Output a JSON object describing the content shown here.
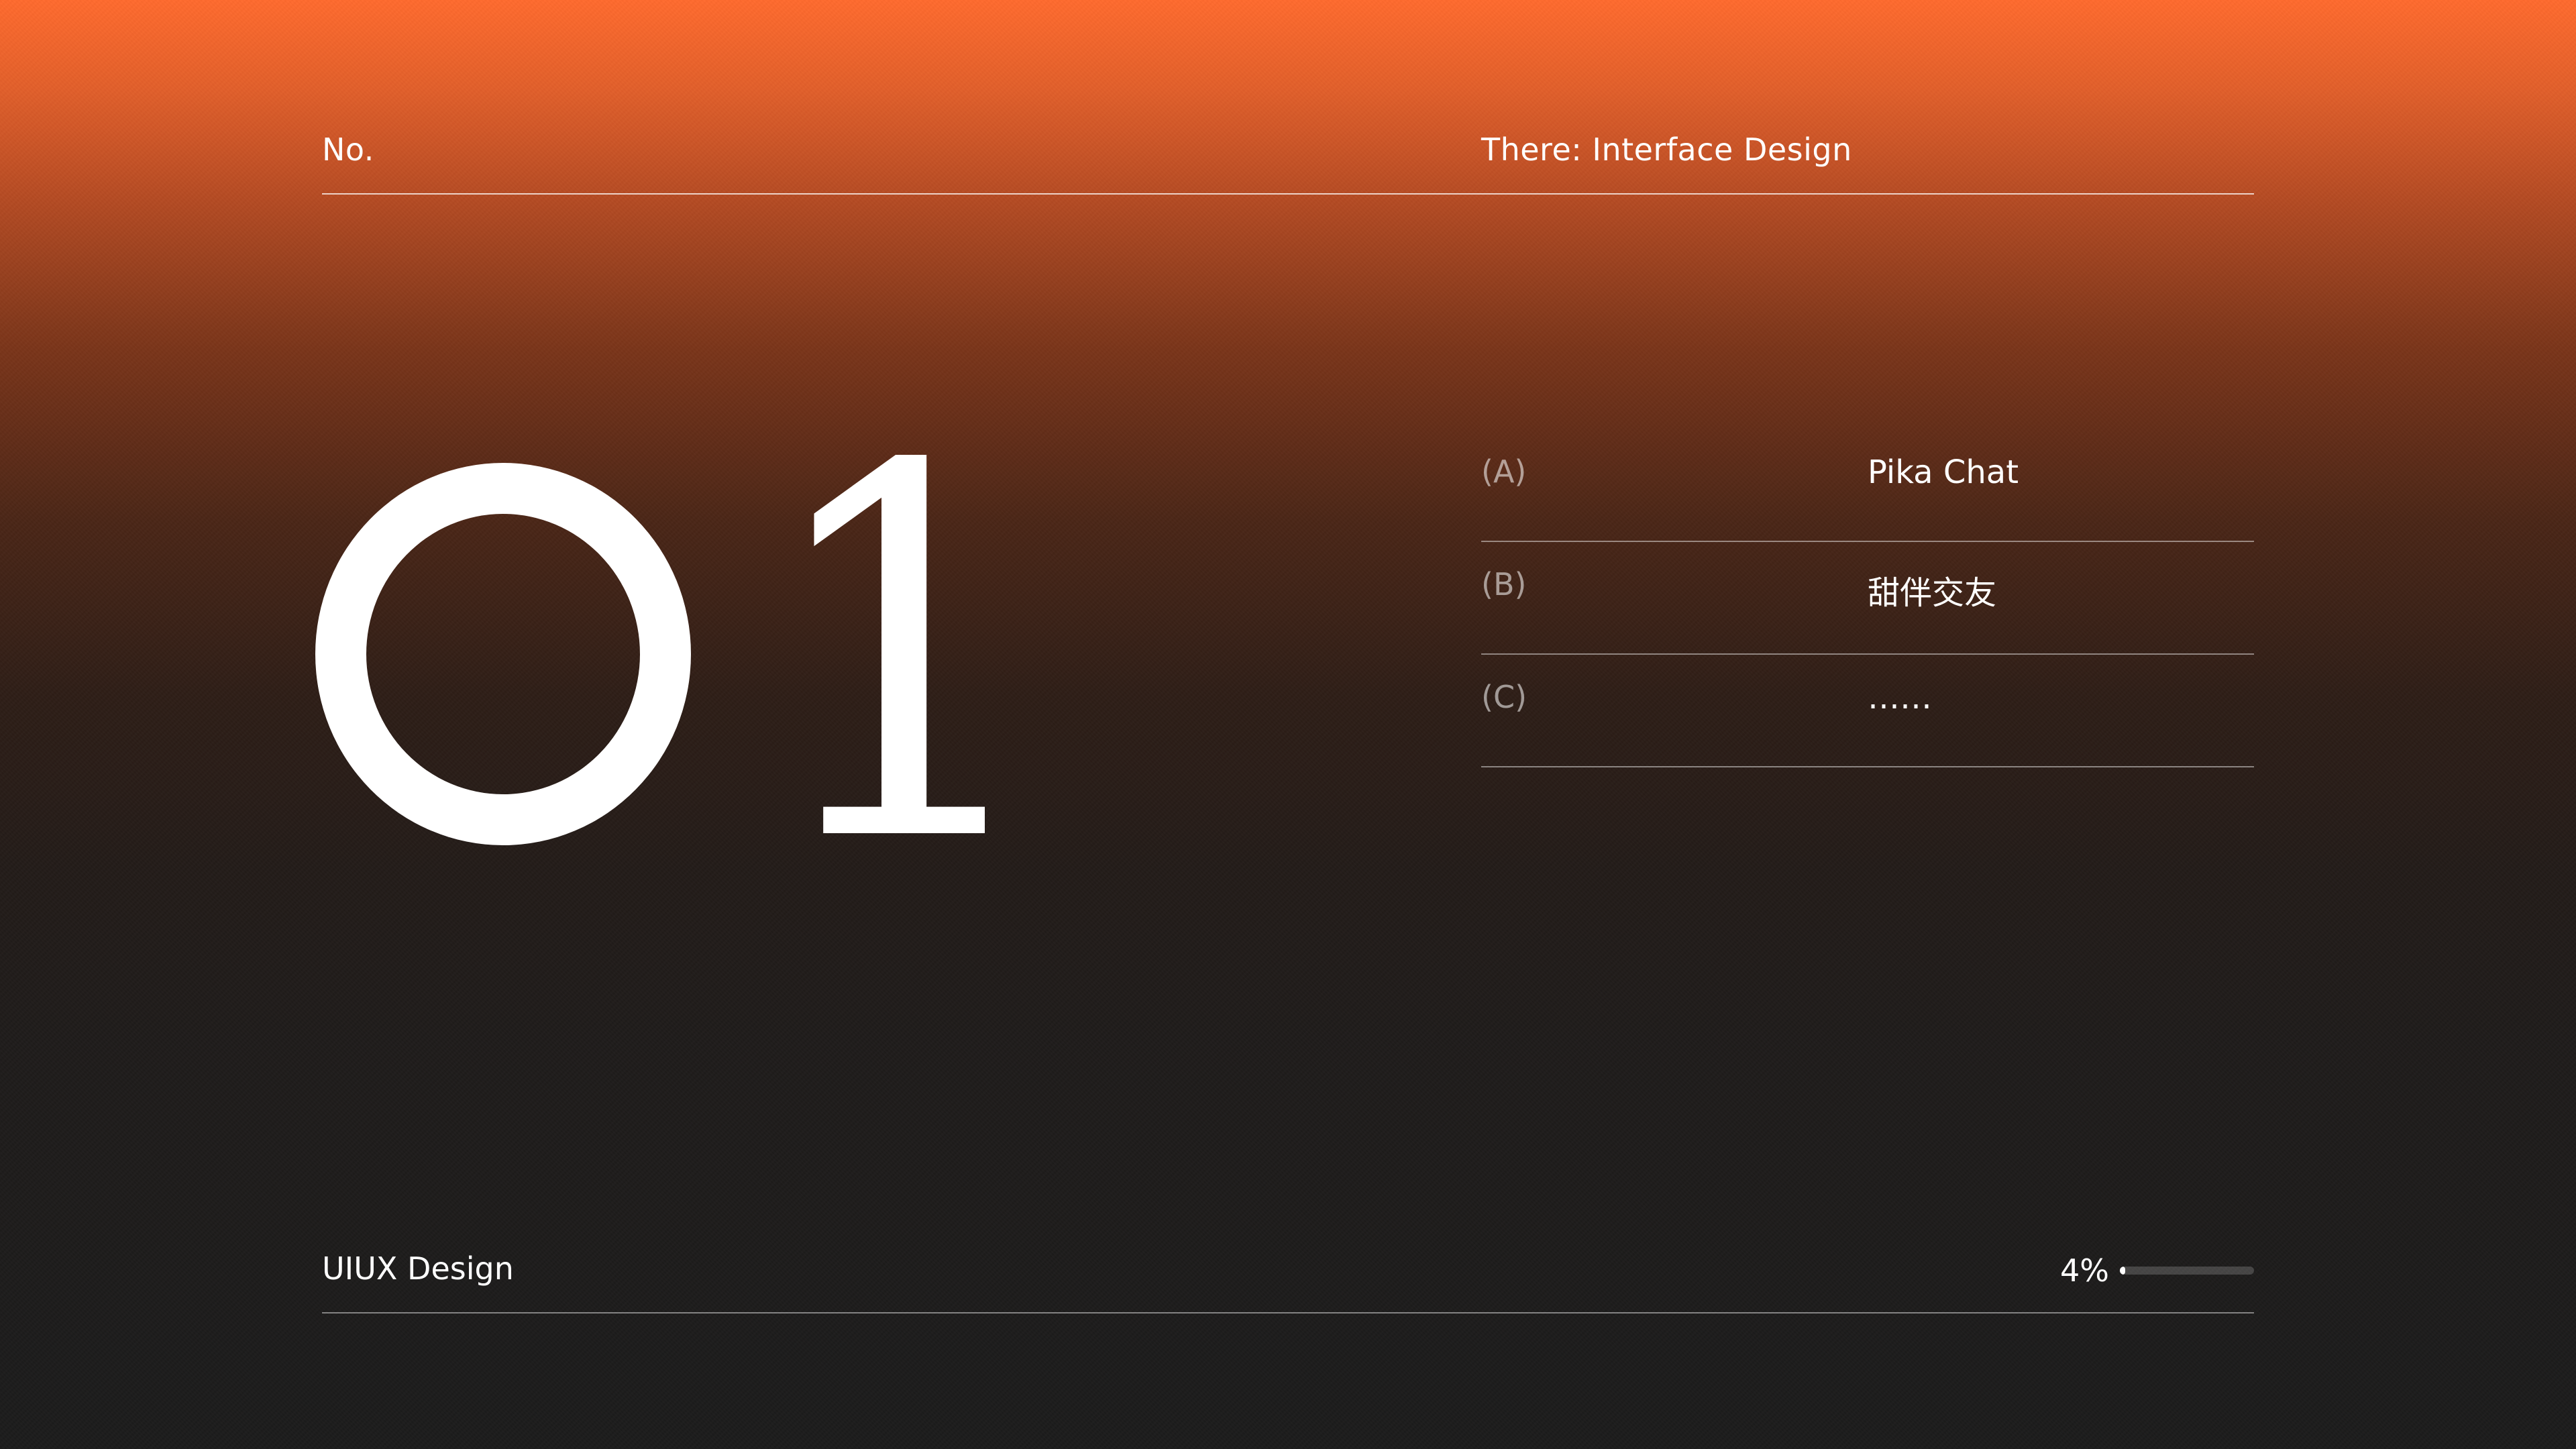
{
  "header": {
    "number_label": "No.",
    "theme": "There: Interface Design"
  },
  "hero": {
    "number": "01"
  },
  "list": [
    {
      "key": "(A)",
      "value": "Pika Chat"
    },
    {
      "key": "(B)",
      "value": "甜伴交友"
    },
    {
      "key": "(C)",
      "value": "……"
    }
  ],
  "footer": {
    "label": "UIUX Design",
    "progress_text": "4%",
    "progress_value": 0.04
  },
  "colors": {
    "gradient_top": "#ff6a2e",
    "gradient_bottom": "#1b1b1b",
    "text": "#ffffff"
  }
}
